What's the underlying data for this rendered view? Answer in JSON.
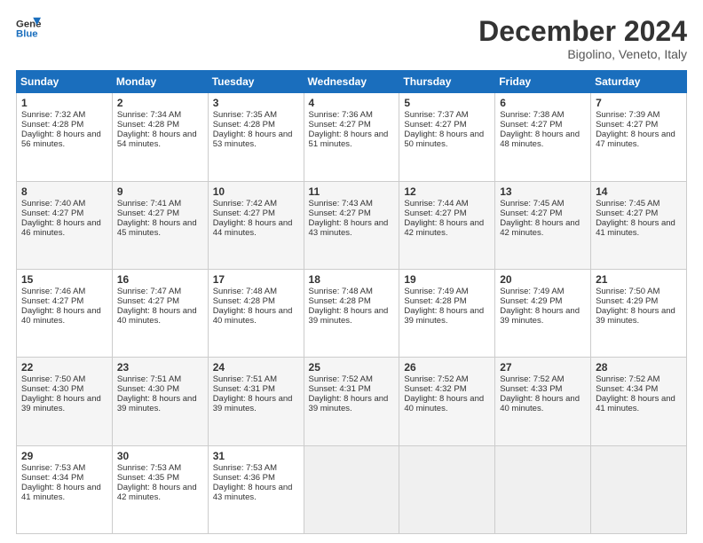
{
  "header": {
    "logo_line1": "General",
    "logo_line2": "Blue",
    "month": "December 2024",
    "location": "Bigolino, Veneto, Italy"
  },
  "weekdays": [
    "Sunday",
    "Monday",
    "Tuesday",
    "Wednesday",
    "Thursday",
    "Friday",
    "Saturday"
  ],
  "weeks": [
    [
      {
        "day": "1",
        "sunrise": "Sunrise: 7:32 AM",
        "sunset": "Sunset: 4:28 PM",
        "daylight": "Daylight: 8 hours and 56 minutes."
      },
      {
        "day": "2",
        "sunrise": "Sunrise: 7:34 AM",
        "sunset": "Sunset: 4:28 PM",
        "daylight": "Daylight: 8 hours and 54 minutes."
      },
      {
        "day": "3",
        "sunrise": "Sunrise: 7:35 AM",
        "sunset": "Sunset: 4:28 PM",
        "daylight": "Daylight: 8 hours and 53 minutes."
      },
      {
        "day": "4",
        "sunrise": "Sunrise: 7:36 AM",
        "sunset": "Sunset: 4:27 PM",
        "daylight": "Daylight: 8 hours and 51 minutes."
      },
      {
        "day": "5",
        "sunrise": "Sunrise: 7:37 AM",
        "sunset": "Sunset: 4:27 PM",
        "daylight": "Daylight: 8 hours and 50 minutes."
      },
      {
        "day": "6",
        "sunrise": "Sunrise: 7:38 AM",
        "sunset": "Sunset: 4:27 PM",
        "daylight": "Daylight: 8 hours and 48 minutes."
      },
      {
        "day": "7",
        "sunrise": "Sunrise: 7:39 AM",
        "sunset": "Sunset: 4:27 PM",
        "daylight": "Daylight: 8 hours and 47 minutes."
      }
    ],
    [
      {
        "day": "8",
        "sunrise": "Sunrise: 7:40 AM",
        "sunset": "Sunset: 4:27 PM",
        "daylight": "Daylight: 8 hours and 46 minutes."
      },
      {
        "day": "9",
        "sunrise": "Sunrise: 7:41 AM",
        "sunset": "Sunset: 4:27 PM",
        "daylight": "Daylight: 8 hours and 45 minutes."
      },
      {
        "day": "10",
        "sunrise": "Sunrise: 7:42 AM",
        "sunset": "Sunset: 4:27 PM",
        "daylight": "Daylight: 8 hours and 44 minutes."
      },
      {
        "day": "11",
        "sunrise": "Sunrise: 7:43 AM",
        "sunset": "Sunset: 4:27 PM",
        "daylight": "Daylight: 8 hours and 43 minutes."
      },
      {
        "day": "12",
        "sunrise": "Sunrise: 7:44 AM",
        "sunset": "Sunset: 4:27 PM",
        "daylight": "Daylight: 8 hours and 42 minutes."
      },
      {
        "day": "13",
        "sunrise": "Sunrise: 7:45 AM",
        "sunset": "Sunset: 4:27 PM",
        "daylight": "Daylight: 8 hours and 42 minutes."
      },
      {
        "day": "14",
        "sunrise": "Sunrise: 7:45 AM",
        "sunset": "Sunset: 4:27 PM",
        "daylight": "Daylight: 8 hours and 41 minutes."
      }
    ],
    [
      {
        "day": "15",
        "sunrise": "Sunrise: 7:46 AM",
        "sunset": "Sunset: 4:27 PM",
        "daylight": "Daylight: 8 hours and 40 minutes."
      },
      {
        "day": "16",
        "sunrise": "Sunrise: 7:47 AM",
        "sunset": "Sunset: 4:27 PM",
        "daylight": "Daylight: 8 hours and 40 minutes."
      },
      {
        "day": "17",
        "sunrise": "Sunrise: 7:48 AM",
        "sunset": "Sunset: 4:28 PM",
        "daylight": "Daylight: 8 hours and 40 minutes."
      },
      {
        "day": "18",
        "sunrise": "Sunrise: 7:48 AM",
        "sunset": "Sunset: 4:28 PM",
        "daylight": "Daylight: 8 hours and 39 minutes."
      },
      {
        "day": "19",
        "sunrise": "Sunrise: 7:49 AM",
        "sunset": "Sunset: 4:28 PM",
        "daylight": "Daylight: 8 hours and 39 minutes."
      },
      {
        "day": "20",
        "sunrise": "Sunrise: 7:49 AM",
        "sunset": "Sunset: 4:29 PM",
        "daylight": "Daylight: 8 hours and 39 minutes."
      },
      {
        "day": "21",
        "sunrise": "Sunrise: 7:50 AM",
        "sunset": "Sunset: 4:29 PM",
        "daylight": "Daylight: 8 hours and 39 minutes."
      }
    ],
    [
      {
        "day": "22",
        "sunrise": "Sunrise: 7:50 AM",
        "sunset": "Sunset: 4:30 PM",
        "daylight": "Daylight: 8 hours and 39 minutes."
      },
      {
        "day": "23",
        "sunrise": "Sunrise: 7:51 AM",
        "sunset": "Sunset: 4:30 PM",
        "daylight": "Daylight: 8 hours and 39 minutes."
      },
      {
        "day": "24",
        "sunrise": "Sunrise: 7:51 AM",
        "sunset": "Sunset: 4:31 PM",
        "daylight": "Daylight: 8 hours and 39 minutes."
      },
      {
        "day": "25",
        "sunrise": "Sunrise: 7:52 AM",
        "sunset": "Sunset: 4:31 PM",
        "daylight": "Daylight: 8 hours and 39 minutes."
      },
      {
        "day": "26",
        "sunrise": "Sunrise: 7:52 AM",
        "sunset": "Sunset: 4:32 PM",
        "daylight": "Daylight: 8 hours and 40 minutes."
      },
      {
        "day": "27",
        "sunrise": "Sunrise: 7:52 AM",
        "sunset": "Sunset: 4:33 PM",
        "daylight": "Daylight: 8 hours and 40 minutes."
      },
      {
        "day": "28",
        "sunrise": "Sunrise: 7:52 AM",
        "sunset": "Sunset: 4:34 PM",
        "daylight": "Daylight: 8 hours and 41 minutes."
      }
    ],
    [
      {
        "day": "29",
        "sunrise": "Sunrise: 7:53 AM",
        "sunset": "Sunset: 4:34 PM",
        "daylight": "Daylight: 8 hours and 41 minutes."
      },
      {
        "day": "30",
        "sunrise": "Sunrise: 7:53 AM",
        "sunset": "Sunset: 4:35 PM",
        "daylight": "Daylight: 8 hours and 42 minutes."
      },
      {
        "day": "31",
        "sunrise": "Sunrise: 7:53 AM",
        "sunset": "Sunset: 4:36 PM",
        "daylight": "Daylight: 8 hours and 43 minutes."
      },
      null,
      null,
      null,
      null
    ]
  ]
}
